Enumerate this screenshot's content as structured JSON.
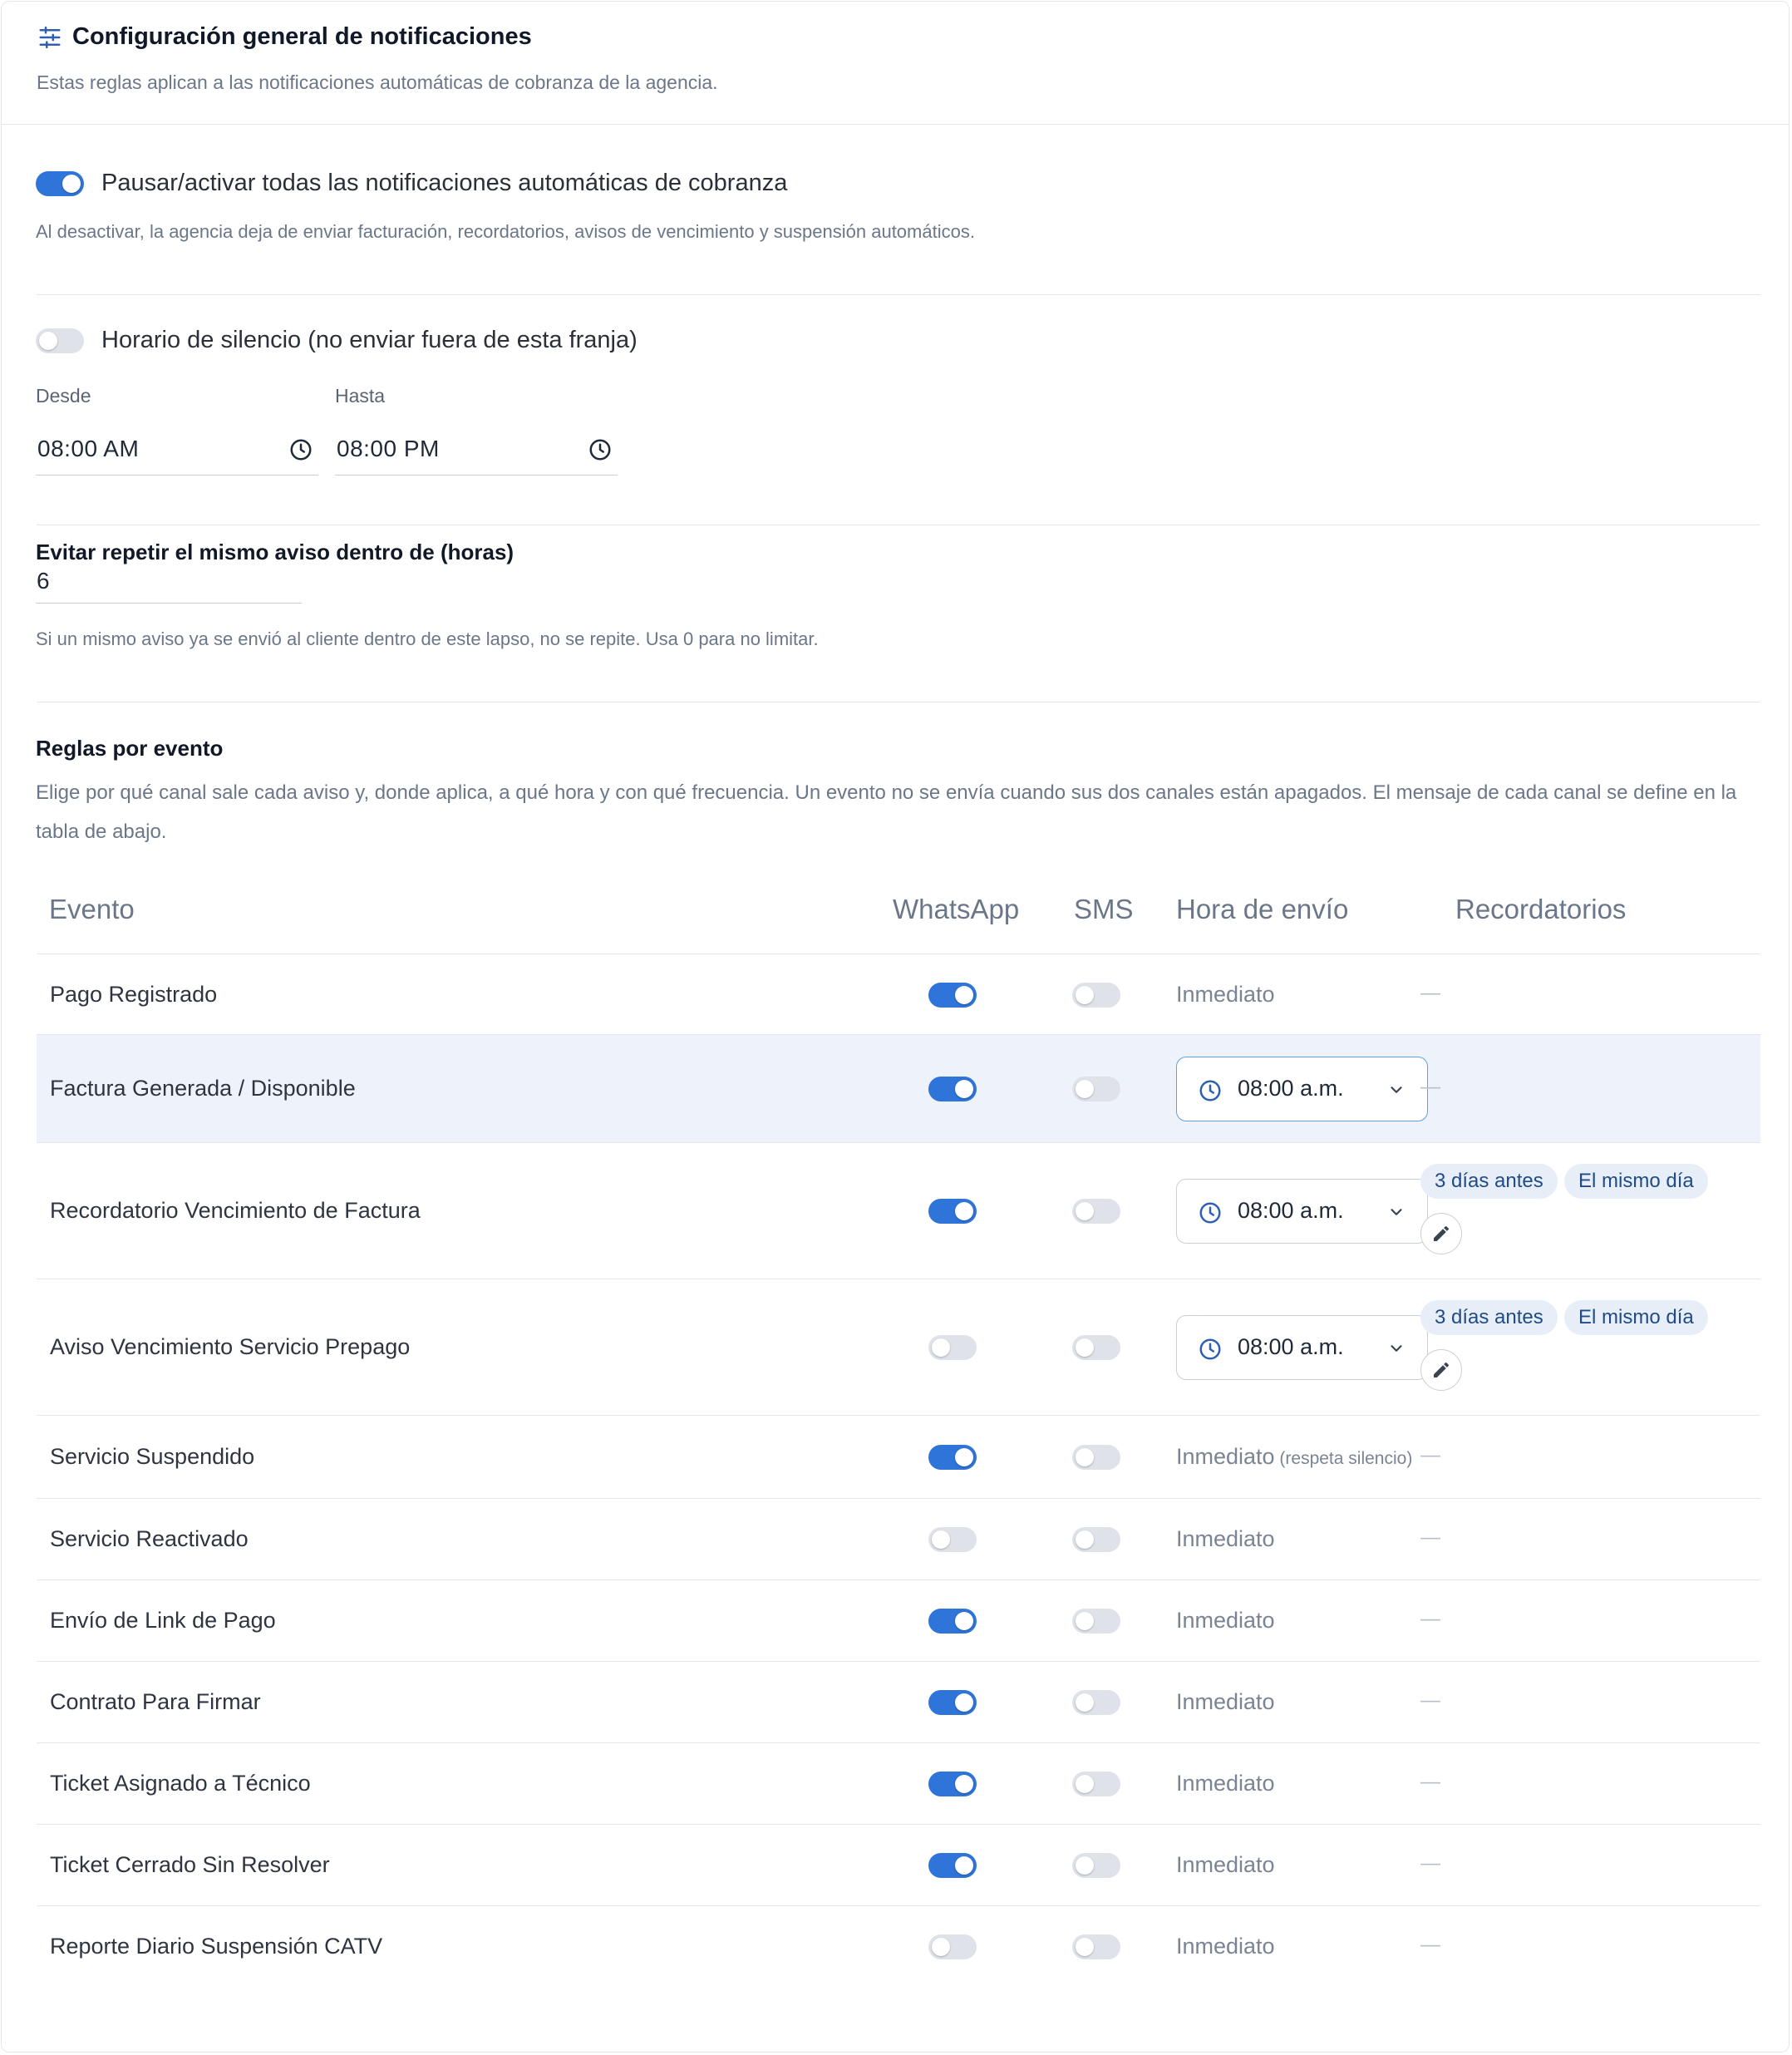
{
  "header": {
    "title": "Configuración general de notificaciones",
    "subtitle": "Estas reglas aplican a las notificaciones automáticas de cobranza de la agencia."
  },
  "master_toggle": {
    "on": true,
    "label": "Pausar/activar todas las notificaciones automáticas de cobranza",
    "help": "Al desactivar, la agencia deja de enviar facturación, recordatorios, avisos de vencimiento y suspensión automáticos."
  },
  "quiet_hours": {
    "on": false,
    "label": "Horario de silencio (no enviar fuera de esta franja)",
    "from_label": "Desde",
    "from_value": "08:00 AM",
    "to_label": "Hasta",
    "to_value": "08:00 PM"
  },
  "repeat": {
    "label": "Evitar repetir el mismo aviso dentro de (horas)",
    "value": "6",
    "help": "Si un mismo aviso ya se envió al cliente dentro de este lapso, no se repite. Usa 0 para no limitar."
  },
  "rules": {
    "title": "Reglas por evento",
    "description": "Elige por qué canal sale cada aviso y, donde aplica, a qué hora y con qué frecuencia. Un evento no se envía cuando sus dos canales están apagados. El mensaje de cada canal se define en la tabla de abajo.",
    "columns": {
      "event": "Evento",
      "whatsapp": "WhatsApp",
      "sms": "SMS",
      "send_time": "Hora de envío",
      "reminders": "Recordatorios"
    },
    "rows": [
      {
        "event": "Pago Registrado",
        "whatsapp": true,
        "sms": false,
        "time": "Inmediato",
        "reminders": "—"
      },
      {
        "event": "Factura Generada / Disponible",
        "whatsapp": true,
        "sms": false,
        "time_select": "08:00 a.m.",
        "reminders": "—",
        "highlighted": true
      },
      {
        "event": "Recordatorio Vencimiento de Factura",
        "whatsapp": true,
        "sms": false,
        "time_select": "08:00 a.m.",
        "chips": [
          "3 días antes",
          "El mismo día"
        ]
      },
      {
        "event": "Aviso Vencimiento Servicio Prepago",
        "whatsapp": false,
        "sms": false,
        "time_select": "08:00 a.m.",
        "chips": [
          "3 días antes",
          "El mismo día"
        ]
      },
      {
        "event": "Servicio Suspendido",
        "whatsapp": true,
        "sms": false,
        "time": "Inmediato",
        "time_note": "(respeta silencio)",
        "reminders": "—"
      },
      {
        "event": "Servicio Reactivado",
        "whatsapp": false,
        "sms": false,
        "time": "Inmediato",
        "reminders": "—"
      },
      {
        "event": "Envío de Link de Pago",
        "whatsapp": true,
        "sms": false,
        "time": "Inmediato",
        "reminders": "—"
      },
      {
        "event": "Contrato Para Firmar",
        "whatsapp": true,
        "sms": false,
        "time": "Inmediato",
        "reminders": "—"
      },
      {
        "event": "Ticket Asignado a Técnico",
        "whatsapp": true,
        "sms": false,
        "time": "Inmediato",
        "reminders": "—"
      },
      {
        "event": "Ticket Cerrado Sin Resolver",
        "whatsapp": true,
        "sms": false,
        "time": "Inmediato",
        "reminders": "—"
      },
      {
        "event": "Reporte Diario Suspensión CATV",
        "whatsapp": false,
        "sms": false,
        "time": "Inmediato",
        "reminders": "—"
      }
    ]
  },
  "icons": {
    "settings": "sliders-icon",
    "clock": "clock-icon",
    "chevron": "chevron-down-icon",
    "edit": "pencil-icon"
  },
  "colors": {
    "accent": "#2f74d8",
    "chip_bg": "#e8eef8",
    "chip_text": "#1f4c86",
    "highlight_row": "#eef3fb"
  }
}
